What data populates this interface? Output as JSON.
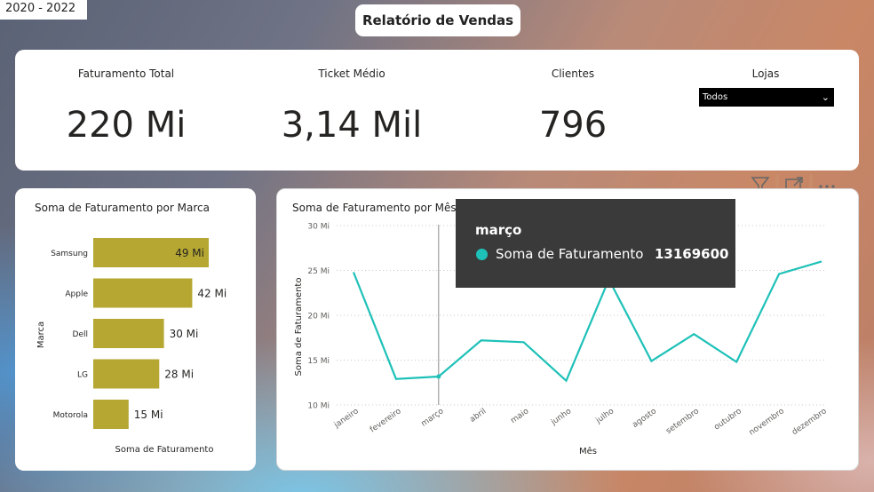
{
  "header": {
    "year_range": "2020 - 2022",
    "report_title": "Relatório de Vendas"
  },
  "kpis": [
    {
      "label": "Faturamento Total",
      "value": "220 Mi"
    },
    {
      "label": "Ticket Médio",
      "value": "3,14 Mil"
    },
    {
      "label": "Clientes",
      "value": "796"
    }
  ],
  "stores_slicer": {
    "label": "Lojas",
    "selected": "Todos"
  },
  "toolbar": {
    "filter_icon": "filter-icon",
    "focus_icon": "focus-mode-icon",
    "more_icon": "more-options-icon"
  },
  "tooltip": {
    "title": "março",
    "series_label": "Soma de Faturamento",
    "value": "13169600"
  },
  "colors": {
    "bar": "#b5a731",
    "line": "#1ec1b8",
    "tooltip_bg": "#3a3a3a"
  },
  "chart_data": [
    {
      "type": "bar",
      "orientation": "horizontal",
      "title": "Soma de Faturamento por Marca",
      "xlabel": "Soma de Faturamento",
      "ylabel": "Marca",
      "categories": [
        "Samsung",
        "Apple",
        "Dell",
        "LG",
        "Motorola"
      ],
      "values": [
        49,
        42,
        30,
        28,
        15
      ],
      "data_labels": [
        "49 Mi",
        "42 Mi",
        "30 Mi",
        "28 Mi",
        "15 Mi"
      ],
      "unit": "Mi",
      "xlim": [
        0,
        49
      ]
    },
    {
      "type": "line",
      "title": "Soma de Faturamento por Mês",
      "xlabel": "Mês",
      "ylabel": "Soma de Faturamento",
      "categories": [
        "janeiro",
        "fevereiro",
        "março",
        "abril",
        "maio",
        "junho",
        "julho",
        "agosto",
        "setembro",
        "outubro",
        "novembro",
        "dezembro"
      ],
      "series": [
        {
          "values": [
            24.8,
            12.9,
            13.17,
            17.2,
            17.0,
            12.7,
            24.0,
            14.9,
            17.9,
            14.8,
            24.6,
            26.0
          ]
        }
      ],
      "ylim": [
        10,
        30
      ],
      "yticks": [
        10,
        15,
        20,
        25,
        30
      ],
      "ytick_labels": [
        "10 Mi",
        "15 Mi",
        "20 Mi",
        "25 Mi",
        "30 Mi"
      ],
      "grid": true,
      "hover_category": "março"
    }
  ]
}
